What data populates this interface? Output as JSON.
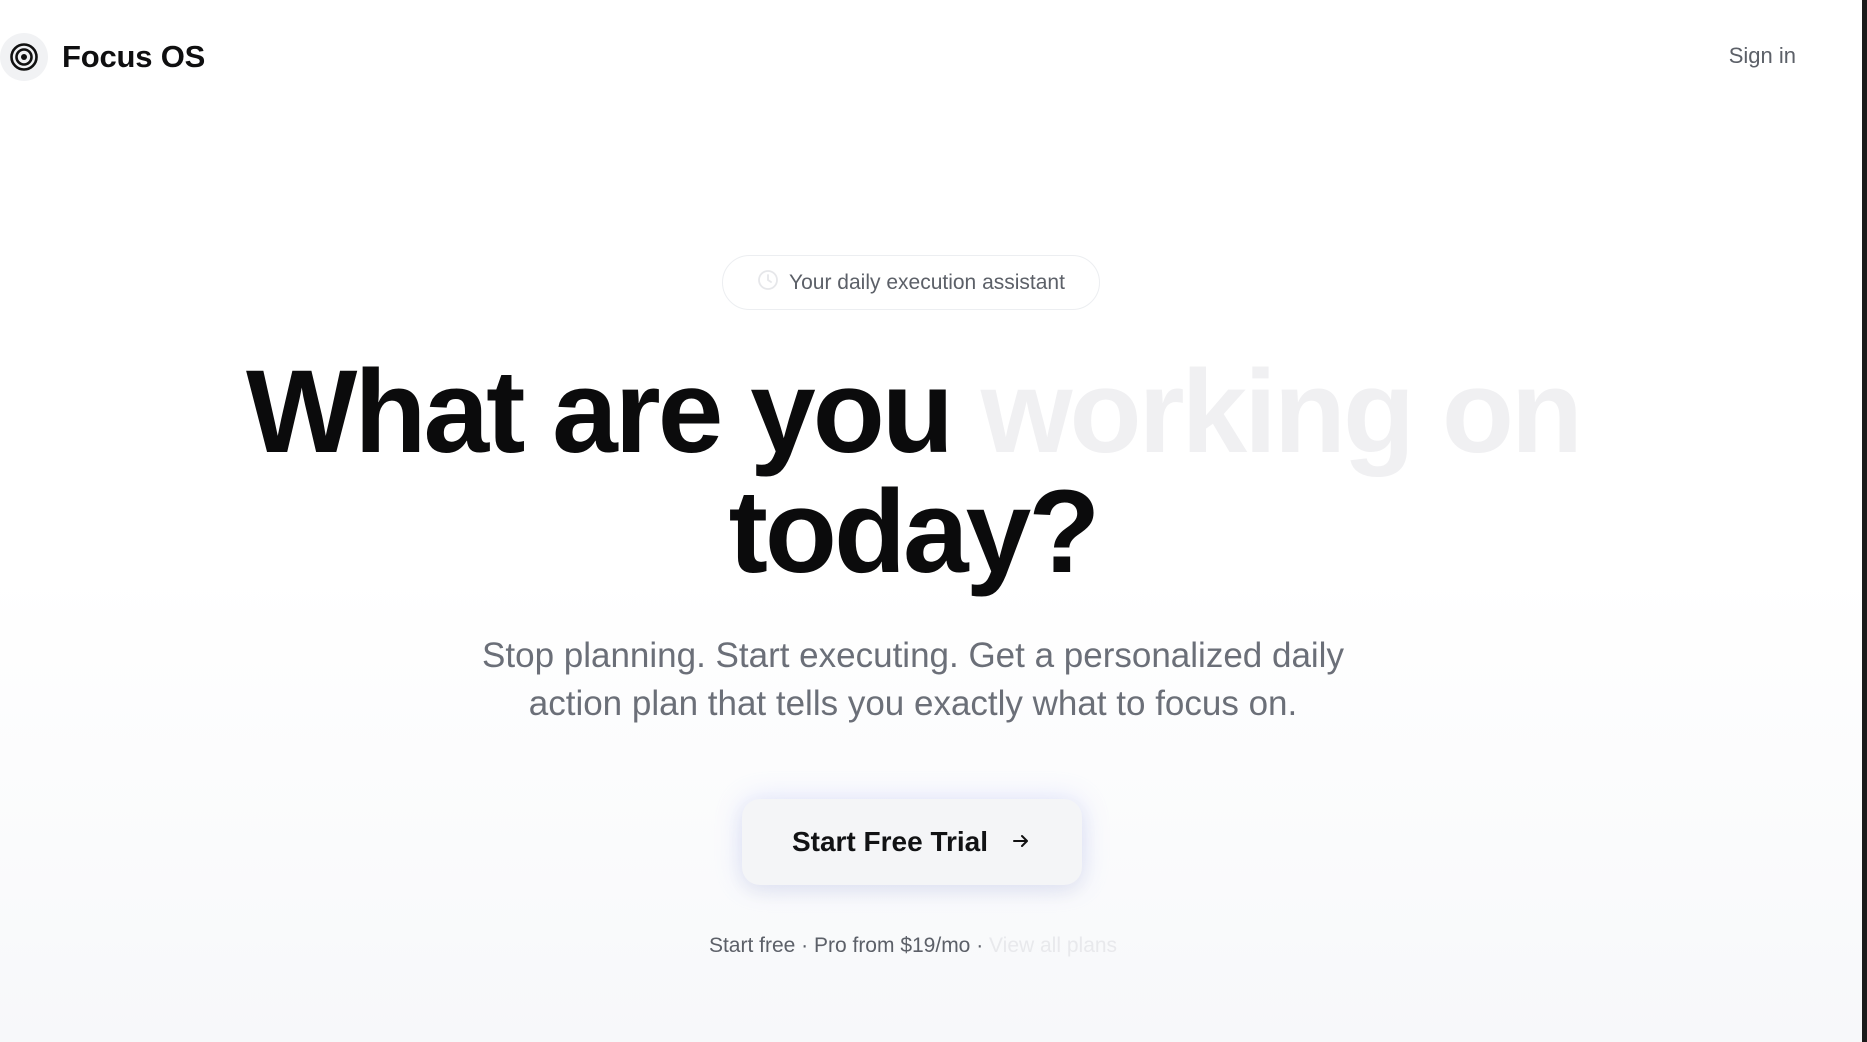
{
  "header": {
    "brand_name": "Focus OS",
    "brand_icon": "target-icon",
    "signin_label": "Sign in"
  },
  "hero": {
    "pill_icon": "clock-icon",
    "pill_text": "Your daily execution assistant",
    "headline_part1": "What are you",
    "headline_faded": "working on",
    "headline_part2": "today?",
    "subtitle_line1": "Stop planning. Start executing. Get a personalized daily",
    "subtitle_line2": "action plan that tells you exactly what to focus on.",
    "cta_label": "Start Free Trial",
    "cta_icon": "arrow-right-icon",
    "pricing_text": "Start free · Pro from $19/mo · ",
    "pricing_link": "View all plans"
  },
  "colors": {
    "text_dark": "#0b0b0c",
    "text_muted": "#6b6f78",
    "faded_text": "#f0f0f2",
    "cta_bg": "#f4f5f7"
  }
}
